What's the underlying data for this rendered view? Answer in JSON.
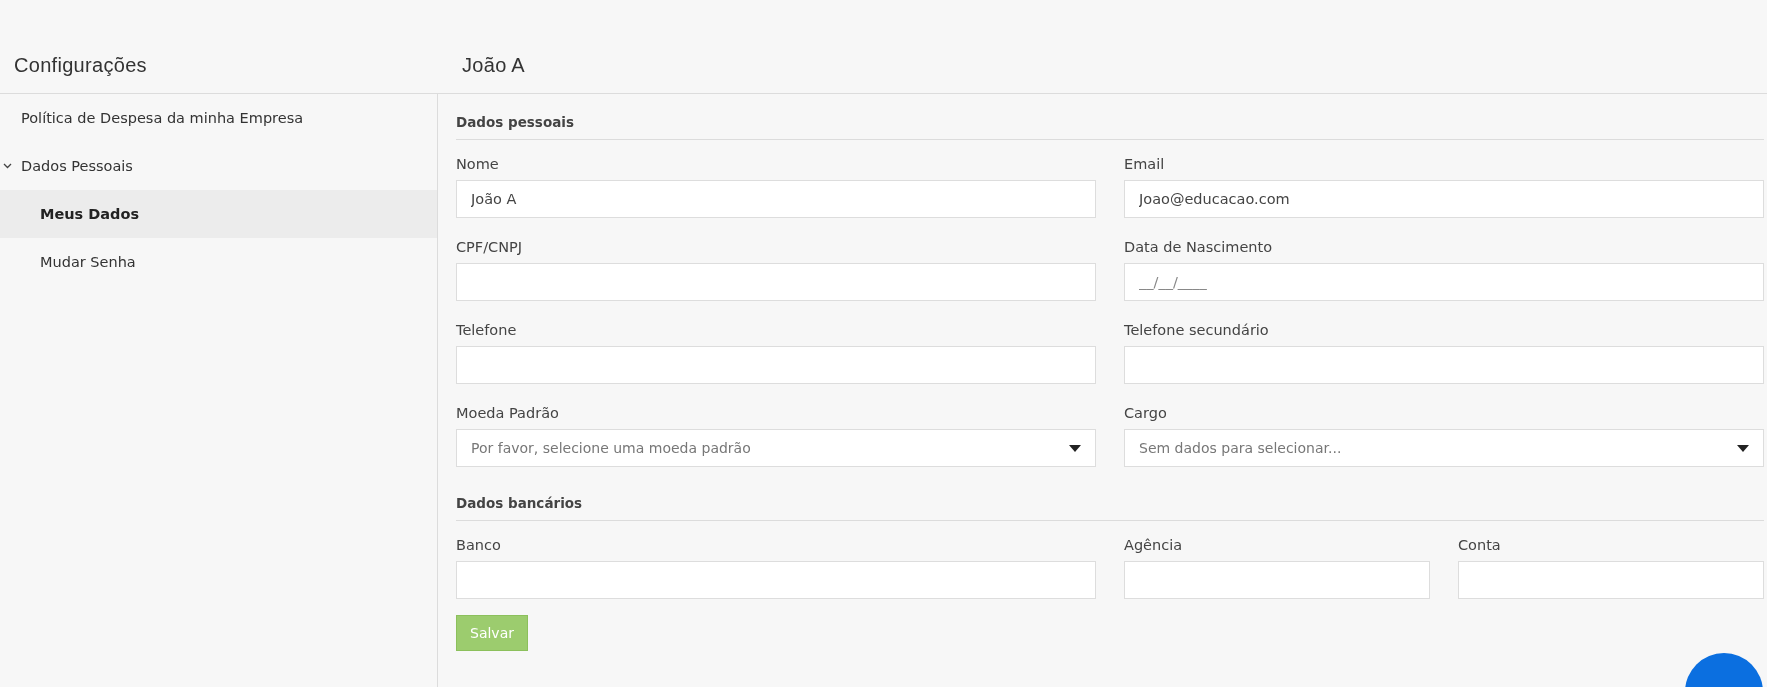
{
  "sidebar": {
    "title": "Configurações",
    "items": [
      {
        "label": "Política de Despesa da minha Empresa",
        "selected": false
      },
      {
        "label": "Dados Pessoais",
        "selected": false,
        "expanded": true,
        "children": [
          {
            "label": "Meus Dados",
            "selected": true
          },
          {
            "label": "Mudar Senha",
            "selected": false
          }
        ]
      }
    ]
  },
  "page_title": "João A",
  "sections": [
    {
      "title": "Dados pessoais",
      "kind": "pairs",
      "fields": [
        {
          "label": "Nome",
          "kind": "text",
          "value": "João A"
        },
        {
          "label": "Email",
          "kind": "text",
          "value": "Joao@educacao.com"
        },
        {
          "label": "CPF/CNPJ",
          "kind": "text"
        },
        {
          "label": "Data de Nascimento",
          "kind": "text",
          "placeholder": "__/__/____"
        },
        {
          "label": "Telefone",
          "kind": "text"
        },
        {
          "label": "Telefone secundário",
          "kind": "text"
        },
        {
          "label": "Moeda Padrão",
          "kind": "select",
          "placeholder": "Por favor, selecione uma moeda padrão"
        },
        {
          "label": "Cargo",
          "kind": "select",
          "placeholder": "Sem dados para selecionar..."
        }
      ]
    },
    {
      "title": "Dados bancários",
      "kind": "bank",
      "fields": [
        {
          "label": "Banco",
          "kind": "text"
        },
        {
          "label": "Agência",
          "kind": "text"
        },
        {
          "label": "Conta",
          "kind": "text"
        }
      ]
    }
  ],
  "save_button": "Salvar"
}
